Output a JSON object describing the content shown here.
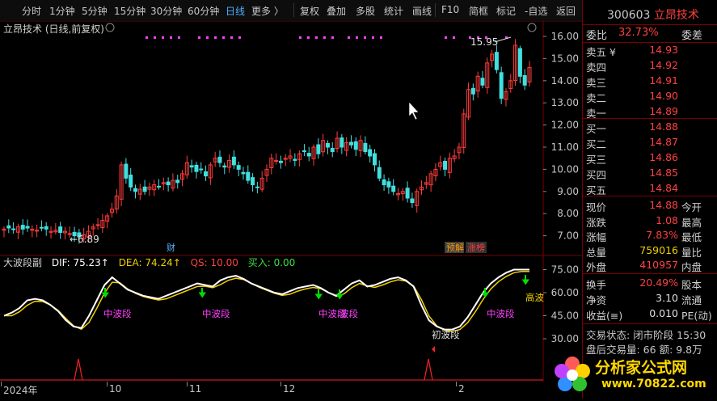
{
  "toolbar": {
    "items": [
      "分时",
      "1分钟",
      "5分钟",
      "15分钟",
      "30分钟",
      "60分钟",
      "日线",
      "更多 〉",
      "复权",
      "叠加",
      "多股",
      "统计",
      "画线",
      "F10",
      "简框",
      "标记",
      "-自选",
      "返回"
    ],
    "active": "日线"
  },
  "chart": {
    "title": "立昂技术 (日线,前复权)",
    "y_ticks": [
      "16.00",
      "15.00",
      "14.00",
      "13.00",
      "12.00",
      "11.00",
      "10.00",
      "9.00",
      "8.00",
      "7.00"
    ],
    "high_label": "15.95",
    "low_label": "6.89",
    "badges": {
      "cai": "财",
      "yujie": "预解",
      "zhangbang": "涨榜"
    }
  },
  "indicator": {
    "name": "大波段副",
    "dif_label": "DIF: 75.23↑",
    "dea_label": "DEA: 74.24↑",
    "qs_label": "QS: 10.00",
    "buy_label": "买入: 0.00",
    "y_ticks": [
      "75.00",
      "60.00",
      "45.00",
      "30.00"
    ],
    "wave_labels": [
      "中波段",
      "中波段",
      "中波段",
      "波段",
      "中波段"
    ],
    "init_label": "初波段",
    "high_label": "高波"
  },
  "date_axis": [
    "2024年",
    "10",
    "11",
    "12",
    "2"
  ],
  "quote": {
    "code": "300603",
    "name": "立昂技术",
    "weibi_label": "委比",
    "weibi_val": "32.73%",
    "weicha_label": "委差",
    "sell": [
      {
        "label": "卖五 ¥",
        "price": "14.93"
      },
      {
        "label": "卖四",
        "price": "14.92"
      },
      {
        "label": "卖三",
        "price": "14.91"
      },
      {
        "label": "卖二",
        "price": "14.90"
      },
      {
        "label": "卖一",
        "price": "14.89"
      }
    ],
    "buy": [
      {
        "label": "买一",
        "price": "14.88"
      },
      {
        "label": "买二",
        "price": "14.87"
      },
      {
        "label": "买三",
        "price": "14.86"
      },
      {
        "label": "买四",
        "price": "14.85"
      },
      {
        "label": "买五",
        "price": "14.84"
      }
    ],
    "stats": [
      {
        "l1": "现价",
        "v1": "14.88",
        "l2": "今开"
      },
      {
        "l1": "涨跌",
        "v1": "1.08",
        "l2": "最高"
      },
      {
        "l1": "涨幅",
        "v1": "7.83%",
        "l2": "最低"
      },
      {
        "l1": "总量",
        "v1": "759016",
        "l2": "量比"
      },
      {
        "l1": "外盘",
        "v1": "410957",
        "l2": "内盘"
      }
    ],
    "stats2": [
      {
        "l1": "换手",
        "v1": "20.49%",
        "l2": "股本"
      },
      {
        "l1": "净资",
        "v1": "3.10",
        "l2": "流通"
      },
      {
        "l1": "收益(≡)",
        "v1": "0.010",
        "l2": "PE(动)"
      }
    ],
    "trade_state": "交易状态: 闭市阶段 15:30",
    "after_trade": "盘后交易量: 66  额: 9.8万"
  },
  "watermark": {
    "text": "分析家公式网",
    "url": "www.70822.com"
  },
  "colors": {
    "up": "#ff3c3c",
    "down": "#40e0e0",
    "dif": "#ffffff",
    "dea": "#f0d000",
    "purple": "#ff40ff",
    "green_arrow": "#00e000"
  }
}
